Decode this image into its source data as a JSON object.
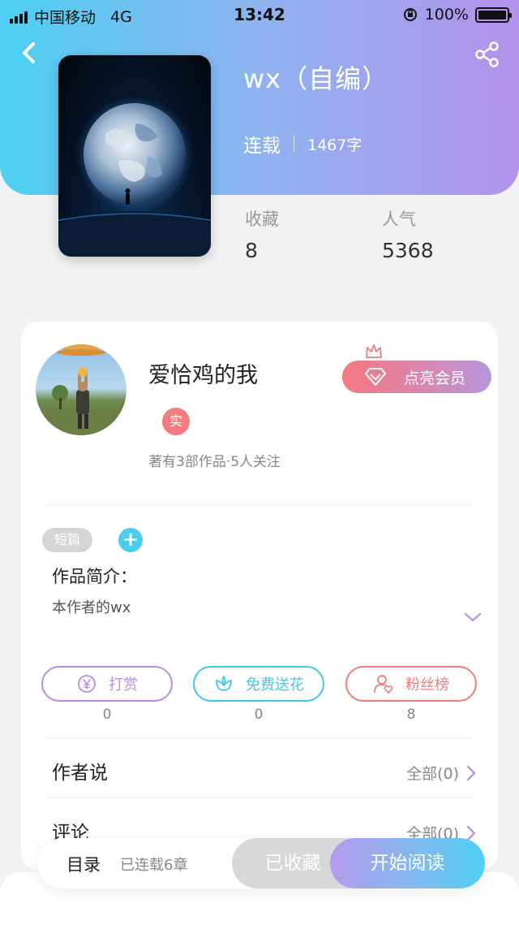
{
  "status_bar": {
    "carrier": "中国移动",
    "network": "4G",
    "time": "13:42",
    "battery": "100%"
  },
  "book": {
    "title": "wx（自编）",
    "status": "连载",
    "word_count": "1467字"
  },
  "stats": [
    {
      "label": "收藏",
      "value": "8"
    },
    {
      "label": "人气",
      "value": "5368"
    }
  ],
  "author": {
    "name": "爱恰鸡的我",
    "verified_badge": "实",
    "summary": "著有3部作品·5人关注",
    "vip_button": "点亮会员"
  },
  "work": {
    "tag": "短篇",
    "intro_title": "作品简介：",
    "intro_text": "本作者的wx"
  },
  "actions": [
    {
      "label": "打赏",
      "count": "0",
      "color": "#b78ee0",
      "icon": "yen-icon"
    },
    {
      "label": "免费送花",
      "count": "0",
      "color": "#3fc9eb",
      "icon": "flower-icon"
    },
    {
      "label": "粉丝榜",
      "count": "8",
      "color": "#ef7b7b",
      "icon": "fans-icon"
    }
  ],
  "sections": {
    "author_says": {
      "title": "作者说",
      "more": "全部(0)"
    },
    "comments": {
      "title": "评论",
      "more": "全部(0)"
    }
  },
  "bottom_bar": {
    "toc": "目录",
    "serial_info": "已连载6章",
    "favorited": "已收藏",
    "start_reading": "开始阅读"
  }
}
